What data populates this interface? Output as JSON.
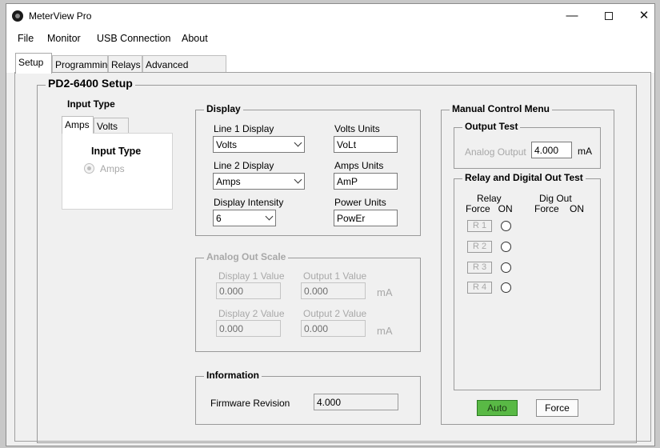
{
  "window": {
    "title": "MeterView Pro"
  },
  "window_controls": {
    "minimize": "—",
    "maximize": "",
    "close": "✕"
  },
  "menu": [
    "File",
    "Monitor",
    "USB Connection",
    "About"
  ],
  "tabs": [
    "Setup",
    "Programming",
    "Relays",
    "Advanced Features"
  ],
  "setup_group": "PD2-6400 Setup",
  "input_type": {
    "title": "Input Type",
    "tabs": [
      "Amps",
      "Volts"
    ],
    "section_title": "Input Type",
    "option": "Amps"
  },
  "display": {
    "title": "Display",
    "line1_label": "Line 1 Display",
    "line1_value": "Volts",
    "line2_label": "Line 2 Display",
    "line2_value": "Amps",
    "intensity_label": "Display Intensity",
    "intensity_value": "6",
    "volts_units_label": "Volts Units",
    "volts_units_value": "VoLt",
    "amps_units_label": "Amps Units",
    "amps_units_value": "AmP",
    "power_units_label": "Power Units",
    "power_units_value": "PowEr"
  },
  "analog_out": {
    "title": "Analog Out Scale",
    "display1_label": "Display 1 Value",
    "display1_value": "0.000",
    "output1_label": "Output 1 Value",
    "output1_value": "0.000",
    "display2_label": "Display 2 Value",
    "display2_value": "0.000",
    "output2_label": "Output 2 Value",
    "output2_value": "0.000",
    "unit": "mA"
  },
  "information": {
    "title": "Information",
    "firmware_label": "Firmware Revision",
    "firmware_value": "4.000"
  },
  "manual": {
    "title": "Manual Control Menu",
    "output_test_title": "Output Test",
    "analog_output_label": "Analog Output",
    "analog_output_value": "4.000",
    "analog_output_unit": "mA",
    "relay_test_title": "Relay and Digital Out Test",
    "relay_header": "Relay",
    "relay_sub": "Force   ON",
    "digout_header": "Dig Out",
    "digout_sub": "Force    ON",
    "relays": [
      "R 1",
      "R 2",
      "R 3",
      "R 4"
    ],
    "auto_label": "Auto",
    "force_label": "Force",
    "auto_color": "#59b945"
  }
}
